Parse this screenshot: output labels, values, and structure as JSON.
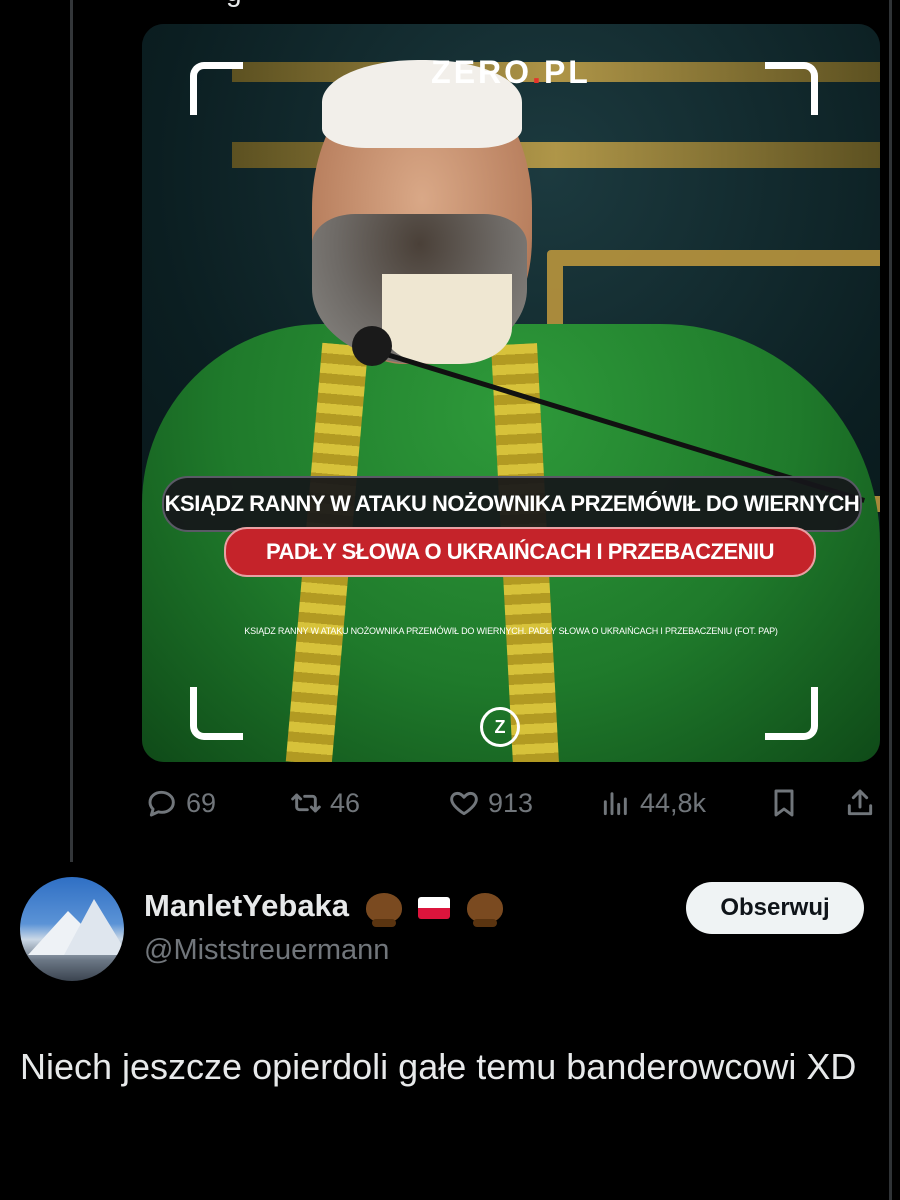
{
  "parent_tweet": {
    "text_fragment": "g",
    "image": {
      "logo": "ZERO",
      "logo_dot": ".",
      "logo_suffix": "PL",
      "headline": "KSIĄDZ RANNY W ATAKU NOŻOWNIKA PRZEMÓWIŁ DO WIERNYCH",
      "subheadline": "PADŁY SŁOWA O UKRAIŃCACH I PRZEBACZENIU",
      "caption": "KSIĄDZ RANNY W ATAKU NOŻOWNIKA PRZEMÓWIŁ DO WIERNYCH. PADŁY SŁOWA O UKRAIŃCACH I PRZEBACZENIU (FOT. PAP)",
      "badge": "Z"
    },
    "actions": {
      "replies": "69",
      "reposts": "46",
      "likes": "913",
      "views": "44,8k"
    }
  },
  "reply": {
    "display_name": "ManletYebaka",
    "name_emojis": [
      "beaver",
      "poland-flag",
      "beaver"
    ],
    "handle": "@Miststreuermann",
    "follow_label": "Obserwuj",
    "text": "Niech jeszcze opierdoli gałe temu banderowcowi XD"
  },
  "icons": [
    "reply-icon",
    "repost-icon",
    "like-icon",
    "views-icon",
    "bookmark-icon",
    "share-icon"
  ],
  "colors": {
    "background": "#000000",
    "text": "#e7e9ea",
    "muted": "#71767b",
    "follow_button_bg": "#eff3f4",
    "headline_red": "#c5232a"
  }
}
